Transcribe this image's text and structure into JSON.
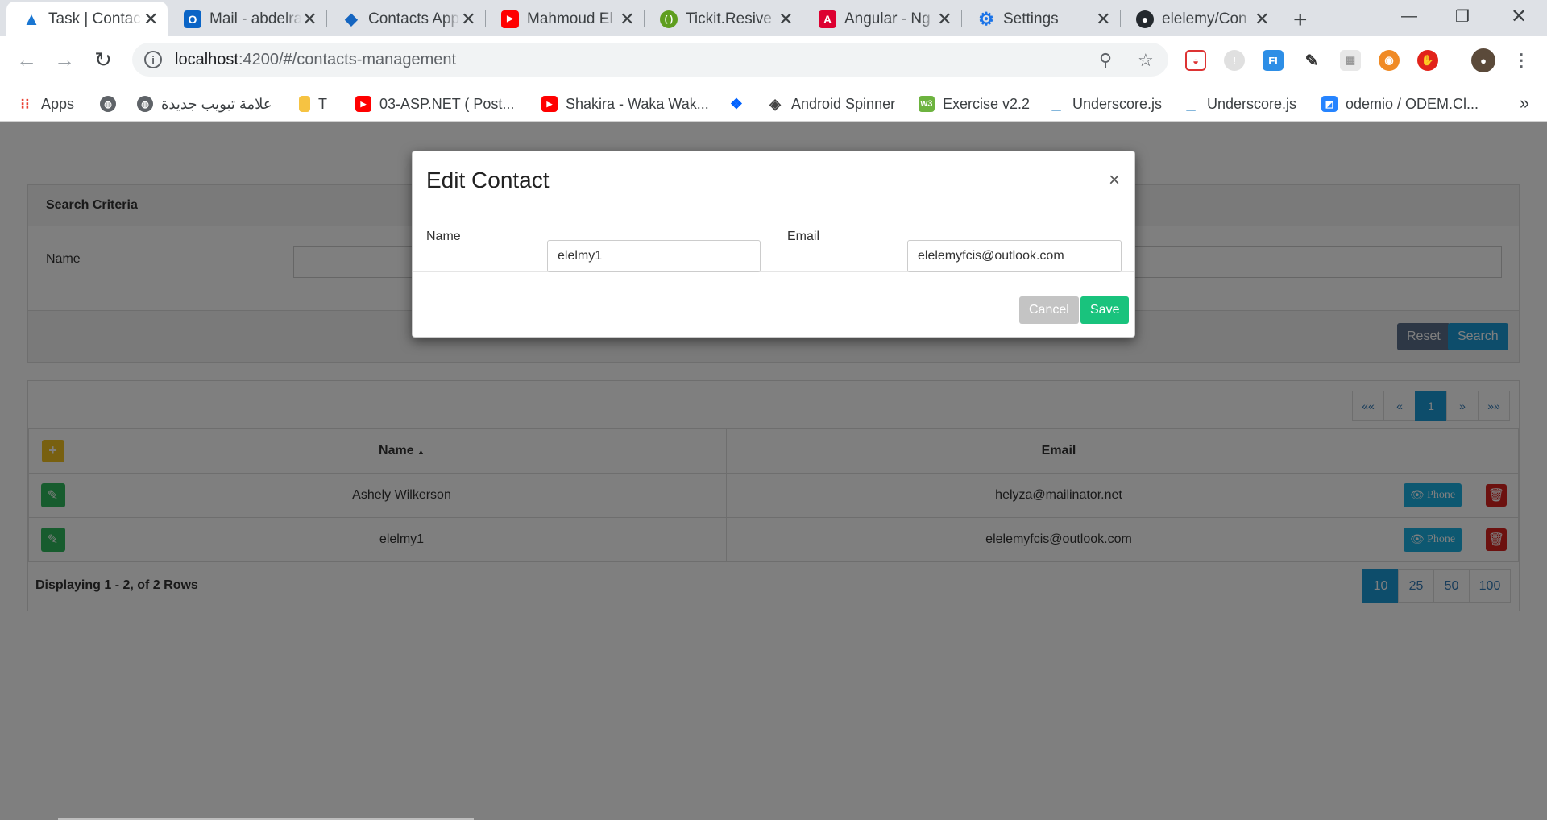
{
  "browser": {
    "tabs": [
      {
        "title": "Task | Contacts",
        "icon": "angular-a-icon",
        "color": "#1976d2",
        "active": true
      },
      {
        "title": "Mail - abdelrahman",
        "icon": "outlook-icon",
        "color": "#0a64c6"
      },
      {
        "title": "Contacts App",
        "icon": "layers-icon",
        "color": "#1565c0"
      },
      {
        "title": "Mahmoud El",
        "icon": "youtube-icon",
        "color": "#ff0000"
      },
      {
        "title": "Tickit.Resive",
        "icon": "bracket-icon",
        "color": "#5f9e1f"
      },
      {
        "title": "Angular - Ng",
        "icon": "angular-icon",
        "color": "#dd0031"
      },
      {
        "title": "Settings",
        "icon": "gear-icon",
        "color": "#1a73e8"
      },
      {
        "title": "elelemy/Con",
        "icon": "github-icon",
        "color": "#24292e"
      }
    ],
    "address": {
      "host": "localhost",
      "rest": ":4200/#/contacts-management"
    },
    "bookmarks": [
      {
        "label": "Apps",
        "icon": "apps-grid-icon"
      },
      {
        "label": "",
        "icon": "globe-icon"
      },
      {
        "label": "علامة تبويب جديدة",
        "icon": "globe-icon"
      },
      {
        "label": "T",
        "icon": "folder-note-icon"
      },
      {
        "label": "03-ASP.NET ( Post...",
        "icon": "youtube-icon"
      },
      {
        "label": "Shakira - Waka Wak...",
        "icon": "youtube-icon"
      },
      {
        "label": "",
        "icon": "dropbox-icon"
      },
      {
        "label": "Android Spinner",
        "icon": "diamond-icon"
      },
      {
        "label": "Exercise v2.2",
        "icon": "w3-icon"
      },
      {
        "label": "Underscore.js",
        "icon": "underscore-icon"
      },
      {
        "label": "Underscore.js",
        "icon": "underscore-icon"
      },
      {
        "label": "odemio / ODEM.Cl...",
        "icon": "bitbucket-icon"
      }
    ]
  },
  "page": {
    "search_panel": {
      "title": "Search Criteria",
      "name_label": "Name",
      "reset_label": "Reset",
      "search_label": "Search"
    },
    "pager": [
      "««",
      "«",
      "1",
      "»",
      "»»"
    ],
    "grid": {
      "columns": [
        "Name",
        "Email"
      ],
      "sort_indicator": "▲",
      "rows": [
        {
          "name": "Ashely Wilkerson",
          "email": "helyza@mailinator.net",
          "phone_label": "Phone"
        },
        {
          "name": "elelmy1",
          "email": "elelemyfcis@outlook.com",
          "phone_label": "Phone"
        }
      ],
      "footer_text": "Displaying 1 - 2, of 2 Rows",
      "page_sizes": [
        "10",
        "25",
        "50",
        "100"
      ],
      "active_page_size": "10"
    }
  },
  "modal": {
    "title": "Edit Contact",
    "close": "×",
    "name_label": "Name",
    "name_value": "elelmy1",
    "email_label": "Email",
    "email_value": "elelemyfcis@outlook.com",
    "cancel_label": "Cancel",
    "save_label": "Save"
  },
  "colors": {
    "cancel": "#c4c4c4",
    "save": "#19c37d",
    "edit": "#2eb85c",
    "delete": "#d9231f",
    "add": "#f0c020",
    "reset": "#5a6e8a",
    "search": "#1a9bd7"
  }
}
